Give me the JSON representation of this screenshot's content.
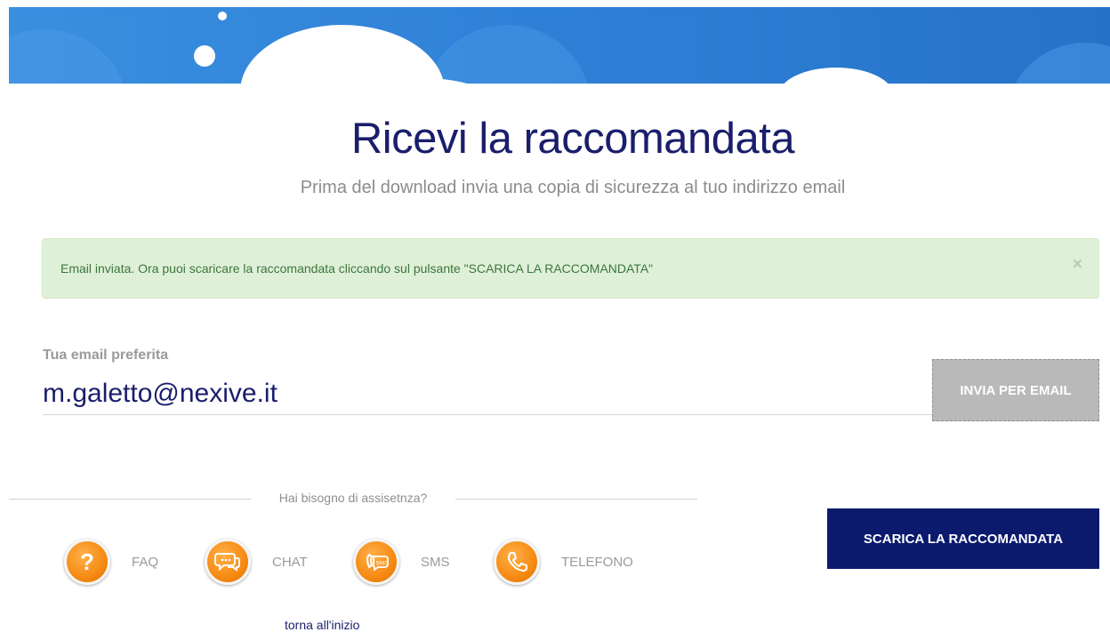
{
  "header": {
    "title": "Ricevi la raccomandata",
    "subtitle": "Prima del download invia una copia di sicurezza al tuo indirizzo email"
  },
  "alert": {
    "message": "Email inviata. Ora puoi scaricare la raccomandata cliccando sul pulsante \"SCARICA LA RACCOMANDATA\"",
    "close": "×"
  },
  "email_form": {
    "label": "Tua email preferita",
    "value": "m.galetto@nexive.it",
    "send_label": "INVIA PER EMAIL"
  },
  "assistance": {
    "heading": "Hai bisogno di assisetnza?",
    "items": [
      {
        "label": "FAQ",
        "icon": "question-icon"
      },
      {
        "label": "CHAT",
        "icon": "chat-icon"
      },
      {
        "label": "SMS",
        "icon": "sms-icon"
      },
      {
        "label": "TELEFONO",
        "icon": "phone-icon"
      }
    ]
  },
  "download_label": "SCARICA LA RACCOMANDATA",
  "back_link": "torna all'inizio",
  "colors": {
    "navy": "#1a1e6b",
    "download_button": "#0c1a6e",
    "sky_blue": "#2f7ed8",
    "alert_bg": "#dff0d8",
    "alert_text": "#3c763d",
    "icon_orange": "#f68a12"
  }
}
